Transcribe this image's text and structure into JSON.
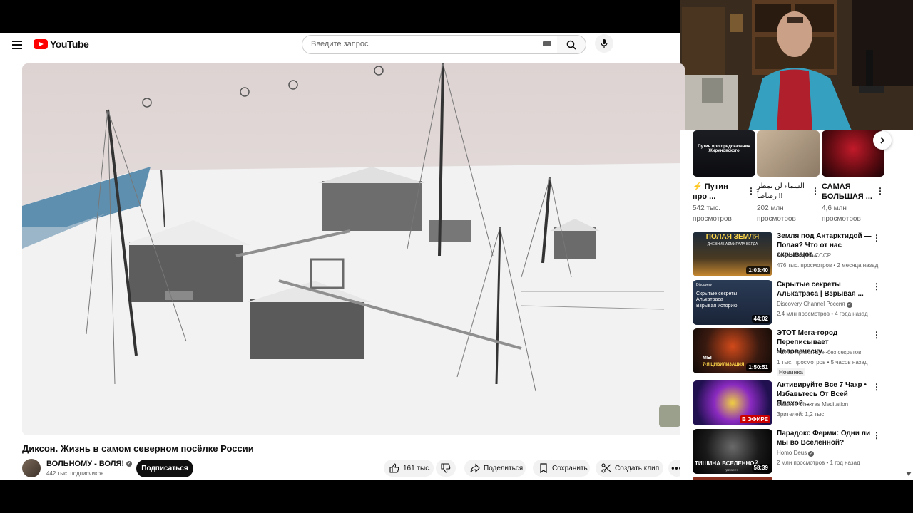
{
  "header": {
    "logo_text": "YouTube",
    "search_placeholder": "Введите запрос"
  },
  "video": {
    "title": "Диксон. Жизнь в самом северном посёлке России",
    "channel_name": "ВОЛЬНОМУ - ВОЛЯ!",
    "subscribers": "442 тыс. подписчиков",
    "subscribe_label": "Подписаться",
    "likes": "161 тыс.",
    "share_label": "Поделиться",
    "save_label": "Сохранить",
    "clip_label": "Создать клип"
  },
  "chips": [
    {
      "title": "Путин про ...",
      "views": "542 тыс.",
      "views_suffix": "просмотров",
      "thumb_text": "Путин про предсказания Жириновского"
    },
    {
      "title": "السماء لن تمطر رصاصاً !!",
      "views": "202 млн",
      "views_suffix": "просмотров"
    },
    {
      "title": "САМАЯ БОЛЬШАЯ ...",
      "views": "4,6 млн",
      "views_suffix": "просмотров"
    }
  ],
  "recommendations": [
    {
      "title": "Земля под Антарктидой — Полая? Что от нас скрывают...",
      "channel": "Тени Истории СССР",
      "meta": "476 тыс. просмотров • 2 месяца назад",
      "duration": "1:03:40",
      "thumb_text": "ПОЛАЯ ЗЕМЛЯ",
      "thumb_sub": "ДНЕВНИК АДМИРАЛА БЁРДА"
    },
    {
      "title": "Скрытые секреты Алькатраса | Взрывая ...",
      "channel": "Discovery Channel Россия",
      "meta": "2,4 млн просмотров • 4 года назад",
      "duration": "44:02",
      "thumb_text": "Скрытые секреты Алькатраса",
      "thumb_sub": "Взрывая историю",
      "thumb_brand": "Discovery"
    },
    {
      "title": "ЭТОТ Мега-город Переписывает Человеческу...",
      "channel": "ADME Археология без секретов",
      "meta": "1 тыс. просмотров • 5 часов назад",
      "duration": "1:50:51",
      "badge": "Новинка",
      "thumb_text": "МЫ",
      "thumb_sub": "7-Я ЦИВИЛИЗАЦИЯ"
    },
    {
      "title": "Активируйте Все 7 Чакр • Избавьтесь От Всей Плохой ...",
      "channel": "Balance Chakras Meditation",
      "meta": "Зрителей: 1,2 тыс.",
      "live": "В ЭФИРЕ"
    },
    {
      "title": "Парадокс Ферми: Одни ли мы во Вселенной?",
      "channel": "Homo Deus",
      "meta": "2 млн просмотров • 1 год назад",
      "duration": "58:39",
      "thumb_text": "ТИШИНА ВСЕЛЕННОЙ",
      "thumb_sub": "ГДЕ ВСЕ?"
    }
  ]
}
